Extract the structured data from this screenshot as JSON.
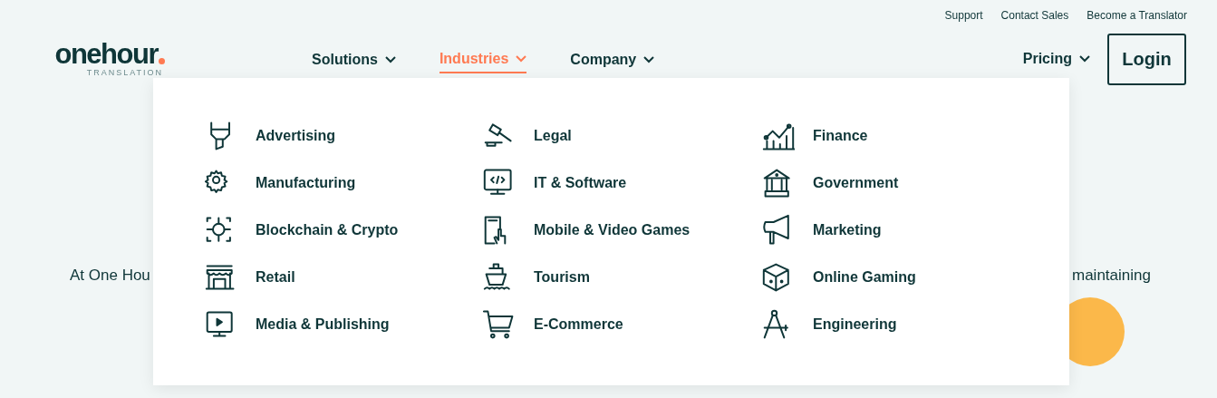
{
  "top_links": [
    "Support",
    "Contact Sales",
    "Become a Translator"
  ],
  "logo": {
    "wordmark": "onehour",
    "tagline": "TRANSLATION"
  },
  "nav": [
    {
      "label": "Solutions",
      "selected": false
    },
    {
      "label": "Industries",
      "selected": true
    },
    {
      "label": "Company",
      "selected": false
    }
  ],
  "pricing": {
    "label": "Pricing"
  },
  "login_button": "Login",
  "background_text": [
    "At One Hou",
    "maintaining"
  ],
  "industries_menu": {
    "columns": [
      [
        "Advertising",
        "Manufacturing",
        "Blockchain & Crypto",
        "Retail",
        "Media & Publishing"
      ],
      [
        "Legal",
        "IT & Software",
        "Mobile & Video Games",
        "Tourism",
        "E-Commerce"
      ],
      [
        "Finance",
        "Government",
        "Marketing",
        "Online Gaming",
        "Engineering"
      ]
    ]
  }
}
